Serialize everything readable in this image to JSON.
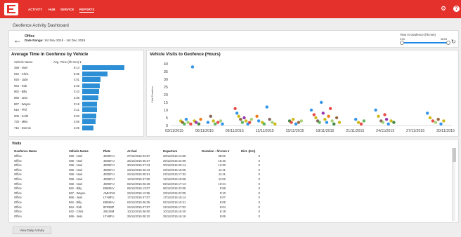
{
  "nav": {
    "items": [
      "ACTIVITY",
      "HUB",
      "SERVICE",
      "REPORTS"
    ],
    "active": "REPORTS"
  },
  "page_title": "Geofence Activity Dashboard",
  "location": {
    "name": "Office",
    "range_label": "Date Range:",
    "range_value": "1st Nov 2015 - 1st Dec 2015"
  },
  "slider": {
    "label": "Time in Geofence (hh:mm)",
    "min": "0:00",
    "max": "38:53"
  },
  "avg_panel": {
    "title": "Average Time in Geofence by Vehicle",
    "col_vehicle": "Vehicle Name",
    "col_time": "Avg. Time (hh:mm) ▾",
    "rows": [
      {
        "name": "358 - Noel",
        "time": "9:14",
        "hours": 9.23
      },
      {
        "name": "942 - Chris",
        "time": "5:36",
        "hours": 5.6
      },
      {
        "name": "925 - Jade",
        "time": "4:01",
        "hours": 4.02
      },
      {
        "name": "964 - Rob",
        "time": "3:46",
        "hours": 3.77
      },
      {
        "name": "962 - Billy",
        "time": "3:43",
        "hours": 3.72
      },
      {
        "name": "866 - Jess",
        "time": "3:36",
        "hours": 3.6
      },
      {
        "name": "867 - Wayne",
        "time": "3:18",
        "hours": 3.3
      },
      {
        "name": "816 - Phil",
        "time": "3:11",
        "hours": 3.18
      },
      {
        "name": "606 - Keith",
        "time": "3:03",
        "hours": 3.05
      },
      {
        "name": "733 - Mike",
        "time": "2:55",
        "hours": 2.92
      },
      {
        "name": "715 - Dennis",
        "time": "2:26",
        "hours": 2.43
      }
    ]
  },
  "chart_data": {
    "type": "scatter",
    "title": "Vehicle Visits to Geofence (Hours)",
    "ylabel": "Visit Duration",
    "xlabel": "",
    "ylim": [
      0,
      40
    ],
    "yticks": [
      0,
      5,
      10,
      15,
      20,
      25,
      30,
      35,
      40
    ],
    "xticks": [
      "03/11/2015",
      "06/11/2015",
      "09/11/2015",
      "12/11/2015",
      "15/11/2015",
      "18/11/2015",
      "21/11/2015",
      "24/11/2015",
      "27/11/2015",
      "30/11/2015"
    ],
    "xlim_days": [
      1,
      32
    ],
    "points": [
      {
        "day": 2.1,
        "y": 3,
        "c": "#c8b400"
      },
      {
        "day": 2.3,
        "y": 2,
        "c": "#8b5a2b"
      },
      {
        "day": 2.5,
        "y": 1,
        "c": "#4caf50"
      },
      {
        "day": 2.7,
        "y": 4,
        "c": "#1e88e5"
      },
      {
        "day": 2.9,
        "y": 2,
        "c": "#9ccc65"
      },
      {
        "day": 3.2,
        "y": 1,
        "c": "#e53935"
      },
      {
        "day": 3.4,
        "y": 38,
        "c": "#1e88e5"
      },
      {
        "day": 3.6,
        "y": 3,
        "c": "#c8b400"
      },
      {
        "day": 3.8,
        "y": 2,
        "c": "#8e24aa"
      },
      {
        "day": 4.1,
        "y": 1,
        "c": "#2e7d32"
      },
      {
        "day": 4.3,
        "y": 4,
        "c": "#ef6c00"
      },
      {
        "day": 5.1,
        "y": 2,
        "c": "#1e88e5"
      },
      {
        "day": 5.4,
        "y": 6,
        "c": "#795548"
      },
      {
        "day": 5.7,
        "y": 3,
        "c": "#c8b400"
      },
      {
        "day": 5.9,
        "y": 1,
        "c": "#4caf50"
      },
      {
        "day": 6.2,
        "y": 2,
        "c": "#e53935"
      },
      {
        "day": 6.5,
        "y": 3,
        "c": "#9ccc65"
      },
      {
        "day": 6.7,
        "y": 1,
        "c": "#1e88e5"
      },
      {
        "day": 8.1,
        "y": 11,
        "c": "#e53935"
      },
      {
        "day": 8.3,
        "y": 8,
        "c": "#1e88e5"
      },
      {
        "day": 8.5,
        "y": 6,
        "c": "#c8b400"
      },
      {
        "day": 8.7,
        "y": 4,
        "c": "#8b5a2b"
      },
      {
        "day": 8.9,
        "y": 2,
        "c": "#4caf50"
      },
      {
        "day": 9.1,
        "y": 5,
        "c": "#8e24aa"
      },
      {
        "day": 9.3,
        "y": 3,
        "c": "#c8b400"
      },
      {
        "day": 9.5,
        "y": 1,
        "c": "#1e88e5"
      },
      {
        "day": 9.7,
        "y": 2,
        "c": "#e53935"
      },
      {
        "day": 9.9,
        "y": 4,
        "c": "#9ccc65"
      },
      {
        "day": 10.5,
        "y": 6,
        "c": "#ef6c00"
      },
      {
        "day": 10.7,
        "y": 3,
        "c": "#1e88e5"
      },
      {
        "day": 11.1,
        "y": 2,
        "c": "#c8b400"
      },
      {
        "day": 11.3,
        "y": 1,
        "c": "#4caf50"
      },
      {
        "day": 11.6,
        "y": 12,
        "c": "#1e88e5"
      },
      {
        "day": 11.9,
        "y": 4,
        "c": "#795548"
      },
      {
        "day": 12.2,
        "y": 2,
        "c": "#9ccc65"
      },
      {
        "day": 12.5,
        "y": 1,
        "c": "#c8b400"
      },
      {
        "day": 14.1,
        "y": 3,
        "c": "#2e7d32"
      },
      {
        "day": 14.3,
        "y": 2,
        "c": "#e53935"
      },
      {
        "day": 14.5,
        "y": 4,
        "c": "#c8b400"
      },
      {
        "day": 14.8,
        "y": 1,
        "c": "#1e88e5"
      },
      {
        "day": 15.1,
        "y": 2,
        "c": "#8b5a2b"
      },
      {
        "day": 15.4,
        "y": 3,
        "c": "#9ccc65"
      },
      {
        "day": 16.5,
        "y": 10,
        "c": "#1e88e5"
      },
      {
        "day": 16.8,
        "y": 7,
        "c": "#e53935"
      },
      {
        "day": 17.0,
        "y": 5,
        "c": "#c8b400"
      },
      {
        "day": 17.2,
        "y": 3,
        "c": "#795548"
      },
      {
        "day": 17.4,
        "y": 2,
        "c": "#4caf50"
      },
      {
        "day": 17.6,
        "y": 15,
        "c": "#1e88e5"
      },
      {
        "day": 17.8,
        "y": 8,
        "c": "#8e24aa"
      },
      {
        "day": 18.0,
        "y": 4,
        "c": "#c8b400"
      },
      {
        "day": 18.2,
        "y": 2,
        "c": "#1e88e5"
      },
      {
        "day": 18.4,
        "y": 6,
        "c": "#ef6c00"
      },
      {
        "day": 18.6,
        "y": 11,
        "c": "#e53935"
      },
      {
        "day": 18.8,
        "y": 3,
        "c": "#9ccc65"
      },
      {
        "day": 19.0,
        "y": 1,
        "c": "#2e7d32"
      },
      {
        "day": 19.3,
        "y": 5,
        "c": "#8b5a2b"
      },
      {
        "day": 19.6,
        "y": 2,
        "c": "#c8b400"
      },
      {
        "day": 21.4,
        "y": 4,
        "c": "#1e88e5"
      },
      {
        "day": 21.7,
        "y": 2,
        "c": "#c8b400"
      },
      {
        "day": 22.0,
        "y": 1,
        "c": "#e53935"
      },
      {
        "day": 22.3,
        "y": 3,
        "c": "#4caf50"
      },
      {
        "day": 23.6,
        "y": 10,
        "c": "#1e88e5"
      },
      {
        "day": 23.9,
        "y": 6,
        "c": "#c8b400"
      },
      {
        "day": 24.2,
        "y": 3,
        "c": "#795548"
      },
      {
        "day": 24.4,
        "y": 2,
        "c": "#9ccc65"
      },
      {
        "day": 24.6,
        "y": 7,
        "c": "#e53935"
      },
      {
        "day": 24.8,
        "y": 4,
        "c": "#8e24aa"
      },
      {
        "day": 25.0,
        "y": 1,
        "c": "#1e88e5"
      },
      {
        "day": 25.3,
        "y": 3,
        "c": "#c8b400"
      },
      {
        "day": 25.6,
        "y": 2,
        "c": "#2e7d32"
      },
      {
        "day": 29.3,
        "y": 8,
        "c": "#1e88e5"
      },
      {
        "day": 29.6,
        "y": 5,
        "c": "#c8b400"
      },
      {
        "day": 29.9,
        "y": 3,
        "c": "#e53935"
      },
      {
        "day": 30.2,
        "y": 2,
        "c": "#9ccc65"
      },
      {
        "day": 30.5,
        "y": 4,
        "c": "#8b5a2b"
      },
      {
        "day": 30.8,
        "y": 1,
        "c": "#1e88e5"
      },
      {
        "day": 31.1,
        "y": 3,
        "c": "#c8b400"
      }
    ]
  },
  "visits": {
    "title": "Visits",
    "columns": [
      "Geofence Name",
      "Vehicle Name",
      "Plate",
      "Arrival",
      "Departure",
      "Duration - hh:mm ▾",
      "Dist. (Km)"
    ],
    "rows": [
      [
        "Office",
        "358 - Noel",
        "4EDBYJ",
        "27/11/2015 03:57",
        "28/11/2015 13:59",
        "38:02",
        "0"
      ],
      [
        "Office",
        "358 - Noel",
        "4EDBYJ",
        "25/11/2015 06:27",
        "26/11/2015 22:09",
        "15:40",
        "0"
      ],
      [
        "Office",
        "358 - Noel",
        "4EDBYJ",
        "30/11/2015 07:43",
        "30/11/2015 20:14",
        "12:30",
        "0"
      ],
      [
        "Office",
        "358 - Noel",
        "4EDBYJ",
        "23/11/2015 06:43",
        "23/11/2015 18:25",
        "11:41",
        "0"
      ],
      [
        "Office",
        "358 - Noel",
        "4EDBYJ",
        "24/11/2015 05:51",
        "24/11/2015 17:32",
        "11:41",
        "0"
      ],
      [
        "Office",
        "358 - Noel",
        "4EDBYJ",
        "12/11/2015 07:06",
        "12/11/2015 18:08",
        "11:02",
        "0"
      ],
      [
        "Office",
        "358 - Noel",
        "4EDBYJ",
        "02/11/2015 06:49",
        "02/11/2015 17:13",
        "10:24",
        "0"
      ],
      [
        "Office",
        "962 - Billy",
        "E85EKV",
        "06/11/2015 13:07",
        "06/11/2015 23:05",
        "9:58",
        "0"
      ],
      [
        "Office",
        "867 - Wayne",
        "AMK2V8",
        "23/11/2015 12:55",
        "23/11/2015 22:05",
        "9:10",
        "0"
      ],
      [
        "Office",
        "866 - Jess",
        "LTH5FU",
        "17/11/2015 07:07",
        "17/11/2015 16:14",
        "9:07",
        "0"
      ],
      [
        "Office",
        "962 - Billy",
        "E85EKV",
        "02/11/2015 06:35",
        "02/11/2015 15:41",
        "9:05",
        "0"
      ],
      [
        "Office",
        "964 - Rob",
        "8FR58P",
        "24/11/2015 07:57",
        "24/11/2015 17:02",
        "9:04",
        "0"
      ],
      [
        "Office",
        "942 - Chris",
        "2BJ25M",
        "10/11/2015 06:00",
        "10/11/2015 16:20",
        "8:19",
        "0"
      ],
      [
        "Office",
        "866 - Jess",
        "LTH5FU",
        "25/11/2015 08:10",
        "25/11/2015 16:16",
        "8:06",
        "0"
      ]
    ]
  },
  "footer": {
    "button": "View Daily Activity"
  }
}
